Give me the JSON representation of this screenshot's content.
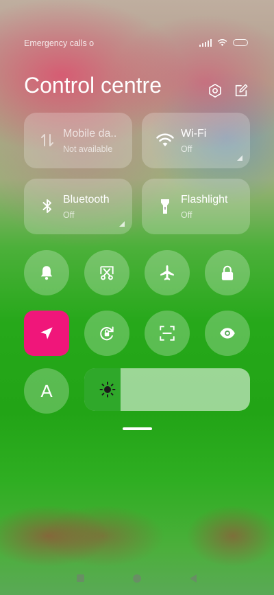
{
  "status_bar": {
    "carrier_text": "Emergency calls o",
    "icons": [
      "signal-icon",
      "wifi-icon",
      "battery-icon"
    ]
  },
  "header": {
    "title": "Control centre",
    "settings_icon": "gear-icon",
    "edit_icon": "edit-icon"
  },
  "tiles": {
    "mobile_data": {
      "label": "Mobile da..",
      "status": "Not available",
      "icon": "mobile-data-icon"
    },
    "wifi": {
      "label": "Wi-Fi",
      "status": "Off",
      "icon": "wifi-icon"
    },
    "bluetooth": {
      "label": "Bluetooth",
      "status": "Off",
      "icon": "bluetooth-icon"
    },
    "flashlight": {
      "label": "Flashlight",
      "status": "Off",
      "icon": "flashlight-icon"
    }
  },
  "toggles": [
    {
      "name": "ringer",
      "icon": "bell-icon"
    },
    {
      "name": "screenshot",
      "icon": "scissors-icon"
    },
    {
      "name": "airplane-mode",
      "icon": "airplane-icon"
    },
    {
      "name": "lock-screen",
      "icon": "lock-icon"
    },
    {
      "name": "location",
      "icon": "location-arrow-icon",
      "active": true
    },
    {
      "name": "auto-rotate",
      "icon": "rotate-lock-icon"
    },
    {
      "name": "scanner",
      "icon": "scan-icon"
    },
    {
      "name": "reading-mode",
      "icon": "eye-icon"
    }
  ],
  "auto_brightness": {
    "label": "A"
  },
  "brightness": {
    "level": 0.22,
    "icon": "sun-icon"
  },
  "colors": {
    "active_toggle": "#f0167a",
    "brightness_fill": "#2fa82a"
  }
}
